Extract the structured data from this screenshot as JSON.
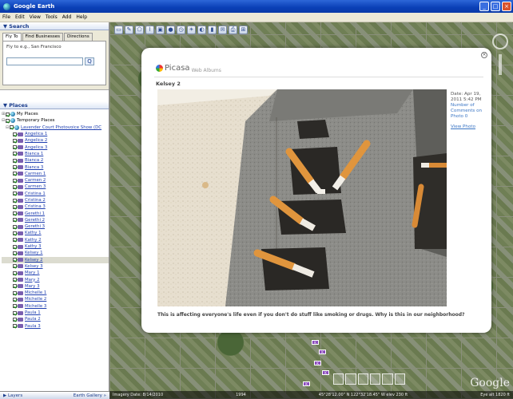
{
  "window": {
    "title": "Google Earth"
  },
  "menu": [
    "File",
    "Edit",
    "View",
    "Tools",
    "Add",
    "Help"
  ],
  "search": {
    "header": "Search",
    "tabs": [
      "Fly To",
      "Find Businesses",
      "Directions"
    ],
    "fly_label": "Fly to e.g., San Francisco",
    "input_value": "",
    "go_label": "Q"
  },
  "places": {
    "header": "Places",
    "root_items": [
      "My Places",
      "Temporary Places"
    ],
    "folder": "Lavender Court Photovoice Show (DC",
    "items": [
      "Angelica 1",
      "Angelica 2",
      "Angelica 3",
      "Bianca 1",
      "Bianca 2",
      "Bianca 3",
      "Carmen 1",
      "Carmen 2",
      "Carmen 3",
      "Cristina 1",
      "Cristina 2",
      "Cristina 3",
      "Gerethi 1",
      "Gerethi 2",
      "Gerethi 3",
      "Kathy 1",
      "Kathy 2",
      "Kathy 3",
      "Kelsey 1",
      "Kelsey 2",
      "Kelsey 3",
      "Mary 1",
      "Mary 2",
      "Mary 3",
      "Michelle 1",
      "Michelle 2",
      "Michelle 3",
      "Paula 1",
      "Paula 2",
      "Paula 3"
    ],
    "selected": "Kelsey 2"
  },
  "bottom_bar": {
    "layers": "Layers",
    "gallery": "Earth Gallery »"
  },
  "popup": {
    "brand": "Picasa",
    "brand_sub": "Web Albums",
    "close": "×",
    "photo_title": "Kelsey 2",
    "meta_date": "Date: Apr 19, 2011 5:42 PM",
    "meta_comments": "Number of Comments on Photo",
    "meta_comments_count": "0",
    "meta_view": "View Photo",
    "caption": "This is affecting everyone's life even if you don't do stuff like smoking or drugs. Why is this in our neighborhood?"
  },
  "map": {
    "logo": "Google",
    "status_left": "Imagery Date: 8/14/2010",
    "status_mid": "1994",
    "status_coords": "45°28'12.00\" N 122°32'18.45\" W  elev 230 ft",
    "status_right": "Eye alt  1820 ft",
    "marker_labels": [
      "K",
      "K",
      "K",
      "K",
      "K"
    ]
  }
}
